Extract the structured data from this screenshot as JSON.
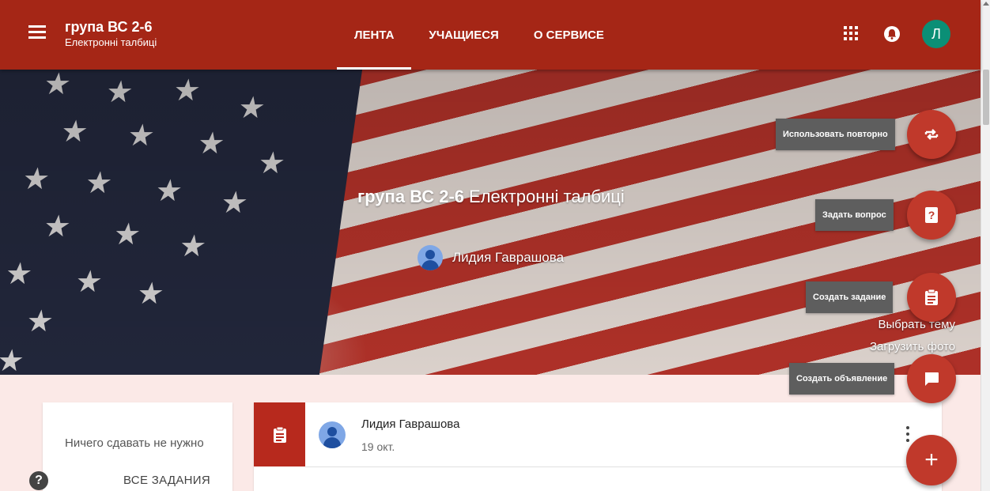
{
  "header": {
    "class_title": "група ВС 2-6",
    "class_subtitle": "Електронні талбиці",
    "tabs": [
      {
        "label": "ЛЕНТА",
        "active": true
      },
      {
        "label": "УЧАЩИЕСЯ",
        "active": false
      },
      {
        "label": "О СЕРВИСЕ",
        "active": false
      }
    ],
    "user_initial": "Л",
    "icons": {
      "menu": "menu-icon",
      "apps": "apps-grid-icon",
      "notifications": "bell-icon"
    }
  },
  "hero": {
    "title": "група ВС 2-6",
    "subtitle": "Електронні талбиці",
    "teacher_name": "Лидия Гаврашова",
    "links": [
      "Выбрать тему",
      "Загрузить фото"
    ]
  },
  "speed_dial": [
    {
      "label": "Использовать повторно",
      "icon": "reuse-icon"
    },
    {
      "label": "Задать вопрос",
      "icon": "question-icon"
    },
    {
      "label": "Создать задание",
      "icon": "assignment-icon"
    },
    {
      "label": "Создать объявление",
      "icon": "announcement-icon"
    }
  ],
  "speed_dial_main": {
    "label": "+"
  },
  "upcoming": {
    "message": "Ничего сдавать не нужно",
    "link": "ВСЕ ЗАДАНИЯ"
  },
  "help": {
    "label": "?"
  },
  "post": {
    "author": "Лидия Гаврашова",
    "date": "19 окт."
  },
  "colors": {
    "header": "#a52616",
    "accent": "#c0392b",
    "avatar_user": "#0b8f76",
    "page_background": "#fbe9e7"
  }
}
